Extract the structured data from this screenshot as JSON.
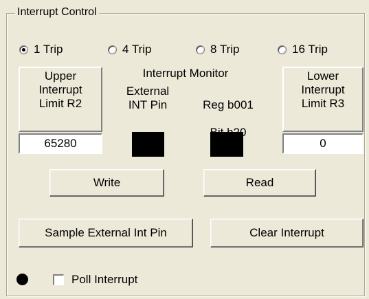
{
  "group": {
    "title": "Interrupt Control"
  },
  "trip_options": [
    {
      "label": "1 Trip",
      "checked": true
    },
    {
      "label": "4 Trip",
      "checked": false
    },
    {
      "label": "8 Trip",
      "checked": false
    },
    {
      "label": "16 Trip",
      "checked": false
    }
  ],
  "upper_limit": {
    "label": "Upper\nInterrupt\nLimit R2",
    "value": "65280"
  },
  "lower_limit": {
    "label": "Lower\nInterrupt\nLimit R3",
    "value": "0"
  },
  "monitor": {
    "title": "Interrupt Monitor",
    "external_label": "External\nINT Pin",
    "reg_label_line1": "Reg b001",
    "reg_label_prefix": "Bit ",
    "reg_label_underlined": "h",
    "reg_label_suffix": "20",
    "led_color": "#000000"
  },
  "buttons": {
    "write": "Write",
    "read": "Read",
    "sample": "Sample External Int Pin",
    "clear": "Clear Interrupt"
  },
  "poll": {
    "label": "Poll Interrupt",
    "checked": false,
    "indicator_color": "#000000"
  }
}
